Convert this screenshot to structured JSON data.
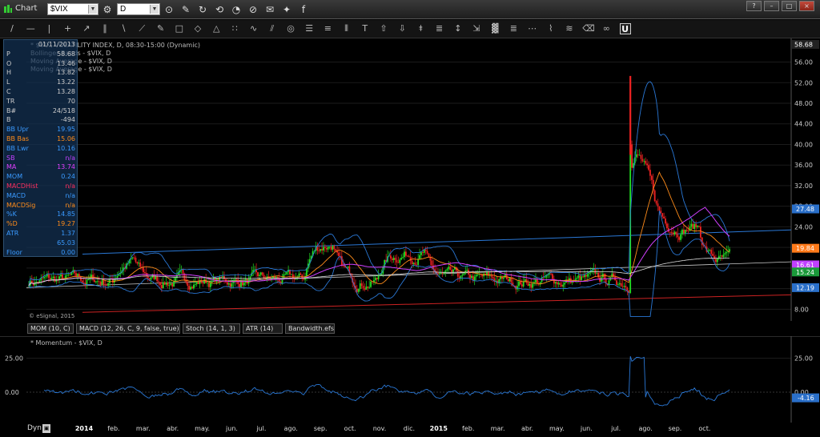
{
  "window": {
    "title": "Chart",
    "symbol_value": "$VIX",
    "interval_value": "D"
  },
  "titlebar_icons": [
    "link-icon",
    "edit-icon",
    "refresh-icon",
    "sync-icon",
    "clock-icon",
    "tag-icon",
    "email-icon",
    "twitter-icon",
    "facebook-icon"
  ],
  "window_buttons": [
    "?",
    "–",
    "□",
    "×"
  ],
  "toolbar": {
    "tools": [
      {
        "name": "line-tool-icon",
        "glyph": "/"
      },
      {
        "name": "horizontal-line-tool-icon",
        "glyph": "—"
      },
      {
        "name": "vertical-line-tool-icon",
        "glyph": "|"
      },
      {
        "name": "crosshair-line-tool-icon",
        "glyph": "+"
      },
      {
        "name": "ray-tool-icon",
        "glyph": "↗"
      },
      {
        "name": "parallel-channel-tool-icon",
        "glyph": "∥"
      },
      {
        "name": "regression-channel-tool-icon",
        "glyph": "∖"
      },
      {
        "name": "extended-line-tool-icon",
        "glyph": "⟋"
      },
      {
        "name": "pen-tool-icon",
        "glyph": "✎"
      },
      {
        "name": "rectangle-tool-icon",
        "glyph": "□"
      },
      {
        "name": "ellipse-tool-icon",
        "glyph": "◇"
      },
      {
        "name": "triangle-tool-icon",
        "glyph": "△"
      },
      {
        "name": "cycle-tool-icon",
        "glyph": "∷"
      },
      {
        "name": "arc-tool-icon",
        "glyph": "∿"
      },
      {
        "name": "fibonacci-fan-tool-icon",
        "glyph": "⫽"
      },
      {
        "name": "circle-tool-icon",
        "glyph": "◎"
      },
      {
        "name": "fibonacci-retracement-tool-icon",
        "glyph": "☰"
      },
      {
        "name": "gann-grid-tool-icon",
        "glyph": "≡"
      },
      {
        "name": "andrews-pitchfork-tool-icon",
        "glyph": "⦀"
      },
      {
        "name": "text-tool-icon",
        "glyph": "T"
      },
      {
        "name": "arrow-up-tool-icon",
        "glyph": "⇧"
      },
      {
        "name": "arrow-down-tool-icon",
        "glyph": "⇩"
      },
      {
        "name": "price-label-tool-icon",
        "glyph": "⯒"
      },
      {
        "name": "volume-profile-tool-icon",
        "glyph": "≣"
      },
      {
        "name": "measure-tool-icon",
        "glyph": "↕"
      },
      {
        "name": "zoom-tool-icon",
        "glyph": "⇲"
      },
      {
        "name": "grid-tool-icon",
        "glyph": "▓"
      },
      {
        "name": "speed-lines-tool-icon",
        "glyph": "≣"
      },
      {
        "name": "time-cycles-tool-icon",
        "glyph": "⋯"
      },
      {
        "name": "elliott-wave-tool-icon",
        "glyph": "⌇"
      },
      {
        "name": "zigzag-tool-icon",
        "glyph": "≋"
      },
      {
        "name": "eraser-tool-icon",
        "glyph": "⌫"
      },
      {
        "name": "link-chart-tool-icon",
        "glyph": "∞"
      },
      {
        "name": "magnet-tool-icon",
        "glyph": "U"
      }
    ]
  },
  "cursor_window": {
    "rows": [
      {
        "k": "",
        "v": "01/11/2013",
        "c": "#cccccc"
      },
      {
        "k": "P",
        "v": "58.68",
        "c": "#cccccc"
      },
      {
        "k": "O",
        "v": "13.46",
        "c": "#cccccc"
      },
      {
        "k": "H",
        "v": "13.82",
        "c": "#cccccc"
      },
      {
        "k": "L",
        "v": "13.22",
        "c": "#cccccc"
      },
      {
        "k": "C",
        "v": "13.28",
        "c": "#cccccc"
      },
      {
        "k": "TR",
        "v": "70",
        "c": "#cccccc"
      },
      {
        "k": "B#",
        "v": "24/518",
        "c": "#cccccc"
      },
      {
        "k": "B",
        "v": "-494",
        "c": "#cccccc"
      },
      {
        "k": "BB Upr",
        "v": "19.95",
        "c": "#3a9aff"
      },
      {
        "k": "BB Bas",
        "v": "15.06",
        "c": "#ff8c1a"
      },
      {
        "k": "BB Lwr",
        "v": "10.16",
        "c": "#3a9aff"
      },
      {
        "k": "SB",
        "v": "n/a",
        "c": "#c040ff"
      },
      {
        "k": "MA",
        "v": "13.74",
        "c": "#e040ff"
      },
      {
        "k": "MOM",
        "v": "0.24",
        "c": "#3a9aff"
      },
      {
        "k": "MACDHist",
        "v": "n/a",
        "c": "#ff3060"
      },
      {
        "k": "MACD",
        "v": "n/a",
        "c": "#3a9aff"
      },
      {
        "k": "MACDSig",
        "v": "n/a",
        "c": "#ff8c1a"
      },
      {
        "k": "%K",
        "v": "14.85",
        "c": "#3a9aff"
      },
      {
        "k": "%D",
        "v": "19.27",
        "c": "#ff8c1a"
      },
      {
        "k": "ATR",
        "v": "1.37",
        "c": "#3a9aff"
      },
      {
        "k": "",
        "v": "65.03",
        "c": "#3a9aff"
      },
      {
        "k": "Floor",
        "v": "0.00",
        "c": "#3a9aff"
      }
    ]
  },
  "legend": {
    "line1": "* $VIX, VOLATILITY INDEX, D, 08:30-15:00 (Dynamic)",
    "line2": "Bollinger Bands - $VIX, D",
    "line3": "Moving Average - $VIX, D",
    "line4": "Moving Average - $VIX, D",
    "watermark": "© eSignal, 2015"
  },
  "price_axis": {
    "ticks": [
      "8.00",
      "12.00",
      "16.00",
      "20.00",
      "24.00",
      "28.00",
      "32.00",
      "36.00",
      "40.00",
      "44.00",
      "48.00",
      "52.00",
      "56.00"
    ],
    "tick_values": [
      8,
      12,
      16,
      20,
      24,
      28,
      32,
      36,
      40,
      44,
      48,
      52,
      56
    ],
    "top_label": "58.68",
    "flags": [
      {
        "label": "27.48",
        "value": 27.48,
        "color": "#2a6fc9"
      },
      {
        "label": "19.84",
        "value": 19.84,
        "color": "#ff7a1a"
      },
      {
        "label": "16.61",
        "value": 16.61,
        "color": "#c040ff"
      },
      {
        "label": "15.24",
        "value": 15.24,
        "color": "#1a9a3a"
      },
      {
        "label": "12.19",
        "value": 12.19,
        "color": "#2a6fc9"
      }
    ]
  },
  "study_tabs": [
    {
      "label": "MOM (10, C)"
    },
    {
      "label": "MACD (12, 26, C, 9, false, true)"
    },
    {
      "label": "Stoch (14, 1, 3)"
    },
    {
      "label": "ATR (14)"
    },
    {
      "label": "Bandwidth.efs"
    }
  ],
  "momentum": {
    "legend": "* Momentum - $VIX, D",
    "ticks": [
      "25.00",
      "0.00"
    ],
    "tick_values": [
      25,
      0
    ],
    "flag": {
      "label": "-4.16",
      "value": -4.16
    }
  },
  "time_axis": {
    "dyn_label": "Dyn",
    "months": [
      {
        "label": "2014",
        "year": true
      },
      {
        "label": "feb.",
        "year": false
      },
      {
        "label": "mar.",
        "year": false
      },
      {
        "label": "abr.",
        "year": false
      },
      {
        "label": "may.",
        "year": false
      },
      {
        "label": "jun.",
        "year": false
      },
      {
        "label": "jul.",
        "year": false
      },
      {
        "label": "ago.",
        "year": false
      },
      {
        "label": "sep.",
        "year": false
      },
      {
        "label": "oct.",
        "year": false
      },
      {
        "label": "nov.",
        "year": false
      },
      {
        "label": "dic.",
        "year": false
      },
      {
        "label": "2015",
        "year": true
      },
      {
        "label": "feb.",
        "year": false
      },
      {
        "label": "mar.",
        "year": false
      },
      {
        "label": "abr.",
        "year": false
      },
      {
        "label": "may.",
        "year": false
      },
      {
        "label": "jun.",
        "year": false
      },
      {
        "label": "jul.",
        "year": false
      },
      {
        "label": "ago.",
        "year": false
      },
      {
        "label": "sep.",
        "year": false
      },
      {
        "label": "oct.",
        "year": false
      }
    ]
  },
  "colors": {
    "up_candle": "#22dd22",
    "down_candle": "#ee2222",
    "bollinger": "#2a78d6",
    "bb_basis": "#ff8c1a",
    "ma_fast": "#d040ff",
    "ma_slow": "#dddddd",
    "trend_upper": "#2a78d6",
    "trend_lower": "#cc2222",
    "trend_mid": "#cccccc",
    "momentum": "#2a78d6"
  }
}
